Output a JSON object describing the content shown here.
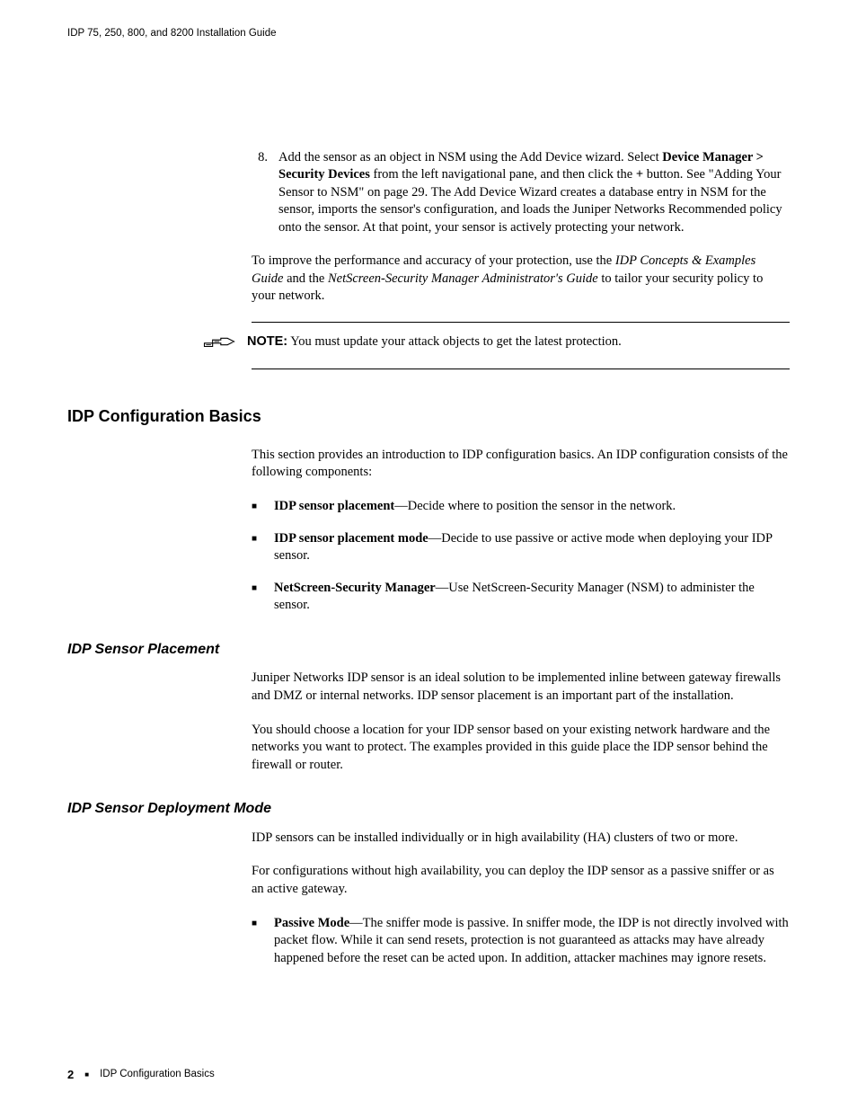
{
  "header": "IDP 75, 250, 800, and 8200 Installation Guide",
  "step8": {
    "num": "8.",
    "pre": "Add the sensor as an object in NSM using the Add Device wizard. Select ",
    "b1": "Device Manager > Security Devices",
    "mid1": " from the left navigational pane, and then click the ",
    "b2": "+",
    "post": " button. See \"Adding Your Sensor to NSM\" on page 29. The Add Device Wizard creates a database entry in NSM for the sensor, imports the sensor's configuration, and loads the Juniper Networks Recommended policy onto the sensor. At that point, your sensor is actively protecting your network."
  },
  "improve": {
    "pre": "To improve the performance and accuracy of your protection, use the ",
    "i1": "IDP Concepts & Examples Guide",
    "mid": " and the ",
    "i2": "NetScreen-Security Manager Administrator's Guide",
    "post": " to tailor your security policy to your network."
  },
  "note": {
    "label": "NOTE:",
    "text": " You must update your attack objects to get the latest protection."
  },
  "h1": "IDP Configuration Basics",
  "intro": "This section provides an introduction to IDP configuration basics. An IDP configuration consists of the following components:",
  "components": [
    {
      "b": "IDP sensor placement",
      "t": "—Decide where to position the sensor in the network."
    },
    {
      "b": "IDP sensor placement mode",
      "t": "—Decide to use passive or active mode when deploying your IDP sensor."
    },
    {
      "b": "NetScreen-Security Manager",
      "t": "—Use NetScreen-Security Manager (NSM) to administer the sensor."
    }
  ],
  "placement": {
    "h": "IDP Sensor Placement",
    "p1": "Juniper Networks IDP sensor is an ideal solution to be implemented inline between gateway firewalls and DMZ or internal networks. IDP sensor placement is an important part of the installation.",
    "p2": "You should choose a location for your IDP sensor based on your existing network hardware and the networks you want to protect. The examples provided in this guide place the IDP sensor behind the firewall or router."
  },
  "deploy": {
    "h": "IDP Sensor Deployment Mode",
    "p1": "IDP sensors can be installed individually or in high availability (HA) clusters of two or more.",
    "p2": "For configurations without high availability, you can deploy the IDP sensor as a passive sniffer or as an active gateway.",
    "bullet": {
      "b": "Passive Mode",
      "t": "—The sniffer mode is passive. In sniffer mode, the IDP is not directly involved with packet flow. While it can send resets, protection is not guaranteed as attacks may have already happened before the reset can be acted upon. In addition, attacker machines may ignore resets."
    }
  },
  "footer": {
    "page": "2",
    "section": "IDP Configuration Basics"
  }
}
